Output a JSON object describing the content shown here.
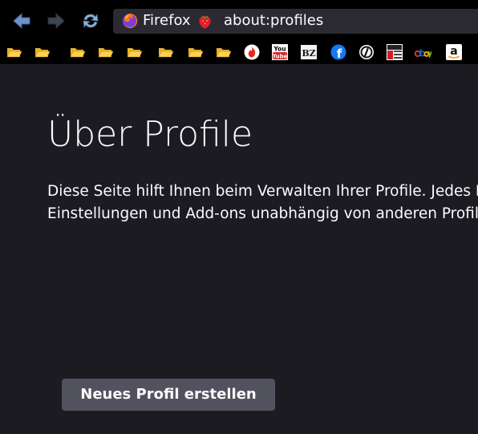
{
  "browser": {
    "identity_label": "Firefox",
    "url": "about:profiles",
    "colors": {
      "chrome": "#000000",
      "urlbar_bg": "#2b2a33",
      "content_bg": "#1c1b22",
      "text": "#fbfbfe",
      "button_bg": "#52525e"
    }
  },
  "navigation": {
    "back_icon": "back-arrow-icon",
    "forward_icon": "forward-arrow-icon",
    "reload_icon": "reload-icon"
  },
  "bookmarks": [
    {
      "name": "folder-1",
      "icon": "folder-icon"
    },
    {
      "name": "folder-2",
      "icon": "folder-icon"
    },
    {
      "name": "folder-3",
      "icon": "folder-icon"
    },
    {
      "name": "folder-4",
      "icon": "folder-icon"
    },
    {
      "name": "folder-5",
      "icon": "folder-icon"
    },
    {
      "name": "folder-6",
      "icon": "folder-icon"
    },
    {
      "name": "folder-7",
      "icon": "folder-icon"
    },
    {
      "name": "folder-8",
      "icon": "folder-icon"
    },
    {
      "name": "flame-site",
      "icon": "flame-icon"
    },
    {
      "name": "youtube",
      "icon": "youtube-icon",
      "text_top": "You",
      "text_bottom": "Tube"
    },
    {
      "name": "bz",
      "icon": "bz-icon",
      "text": "BZ"
    },
    {
      "name": "facebook",
      "icon": "facebook-icon",
      "text": "f"
    },
    {
      "name": "at-site",
      "icon": "at-icon"
    },
    {
      "name": "news-site",
      "icon": "newspaper-icon"
    },
    {
      "name": "ebay",
      "icon": "ebay-icon"
    },
    {
      "name": "amazon",
      "icon": "amazon-icon",
      "text": "a"
    }
  ],
  "page": {
    "title": "Über Profile",
    "description_line1": "Diese Seite hilft Ihnen beim Verwalten Ihrer Profile. Jedes Profil",
    "description_line2": "Einstellungen und Add-ons unabhängig von anderen Profilen",
    "create_button_label": "Neues Profil erstellen"
  }
}
